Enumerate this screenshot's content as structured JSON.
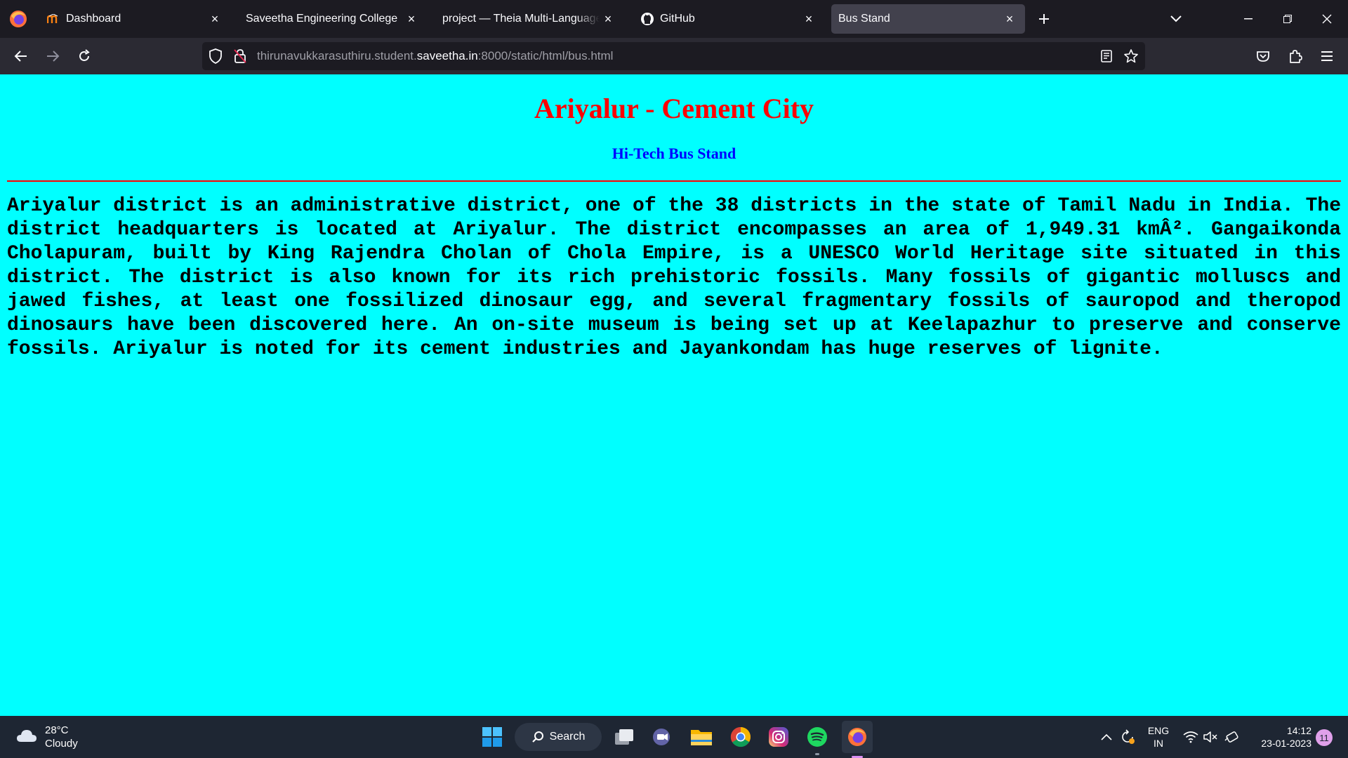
{
  "browser": {
    "tabs": [
      {
        "title": "Dashboard",
        "favicon": "moodle-icon",
        "active": false
      },
      {
        "title": "Saveetha Engineering College",
        "favicon": "none",
        "active": false
      },
      {
        "title": "project — Theia Multi-Language Ex",
        "favicon": "none",
        "active": false
      },
      {
        "title": "GitHub",
        "favicon": "github-icon",
        "active": false
      },
      {
        "title": "Bus Stand",
        "favicon": "none",
        "active": true
      }
    ],
    "url": {
      "prefix": "thirunavukkarasuthiru.student.",
      "domain": "saveetha.in",
      "suffix": ":8000/static/html/bus.html"
    }
  },
  "page": {
    "background": "#00ffff",
    "title": "Ariyalur - Cement City",
    "title_color": "#ff0000",
    "subtitle": "Hi-Tech Bus Stand",
    "subtitle_color": "#0000ff",
    "rule_color": "#ff0000",
    "paragraph": "Ariyalur district is an administrative district, one of the 38 districts in the state of Tamil Nadu in India. The district headquarters is located at Ariyalur. The district encompasses an area of 1,949.31 kmÂ². Gangaikonda Cholapuram, built by King Rajendra Cholan of Chola Empire, is a UNESCO World Heritage site situated in this district. The district is also known for its rich prehistoric fossils. Many fossils of gigantic molluscs and jawed fishes, at least one fossilized dinosaur egg, and several fragmentary fossils of sauropod and theropod dinosaurs have been discovered here. An on-site museum is being set up at Keelapazhur to preserve and conserve fossils. Ariyalur is noted for its cement industries and Jayankondam has huge reserves of lignite."
  },
  "taskbar": {
    "weather": {
      "temp": "28°C",
      "condition": "Cloudy"
    },
    "search_label": "Search",
    "apps": [
      "start-icon",
      "task-view-icon",
      "teams-chat-icon",
      "file-explorer-icon",
      "chrome-icon",
      "instagram-icon",
      "spotify-icon",
      "firefox-icon"
    ],
    "language": {
      "line1": "ENG",
      "line2": "IN"
    },
    "time": "14:12",
    "date": "23-01-2023",
    "notification_count": "11"
  }
}
